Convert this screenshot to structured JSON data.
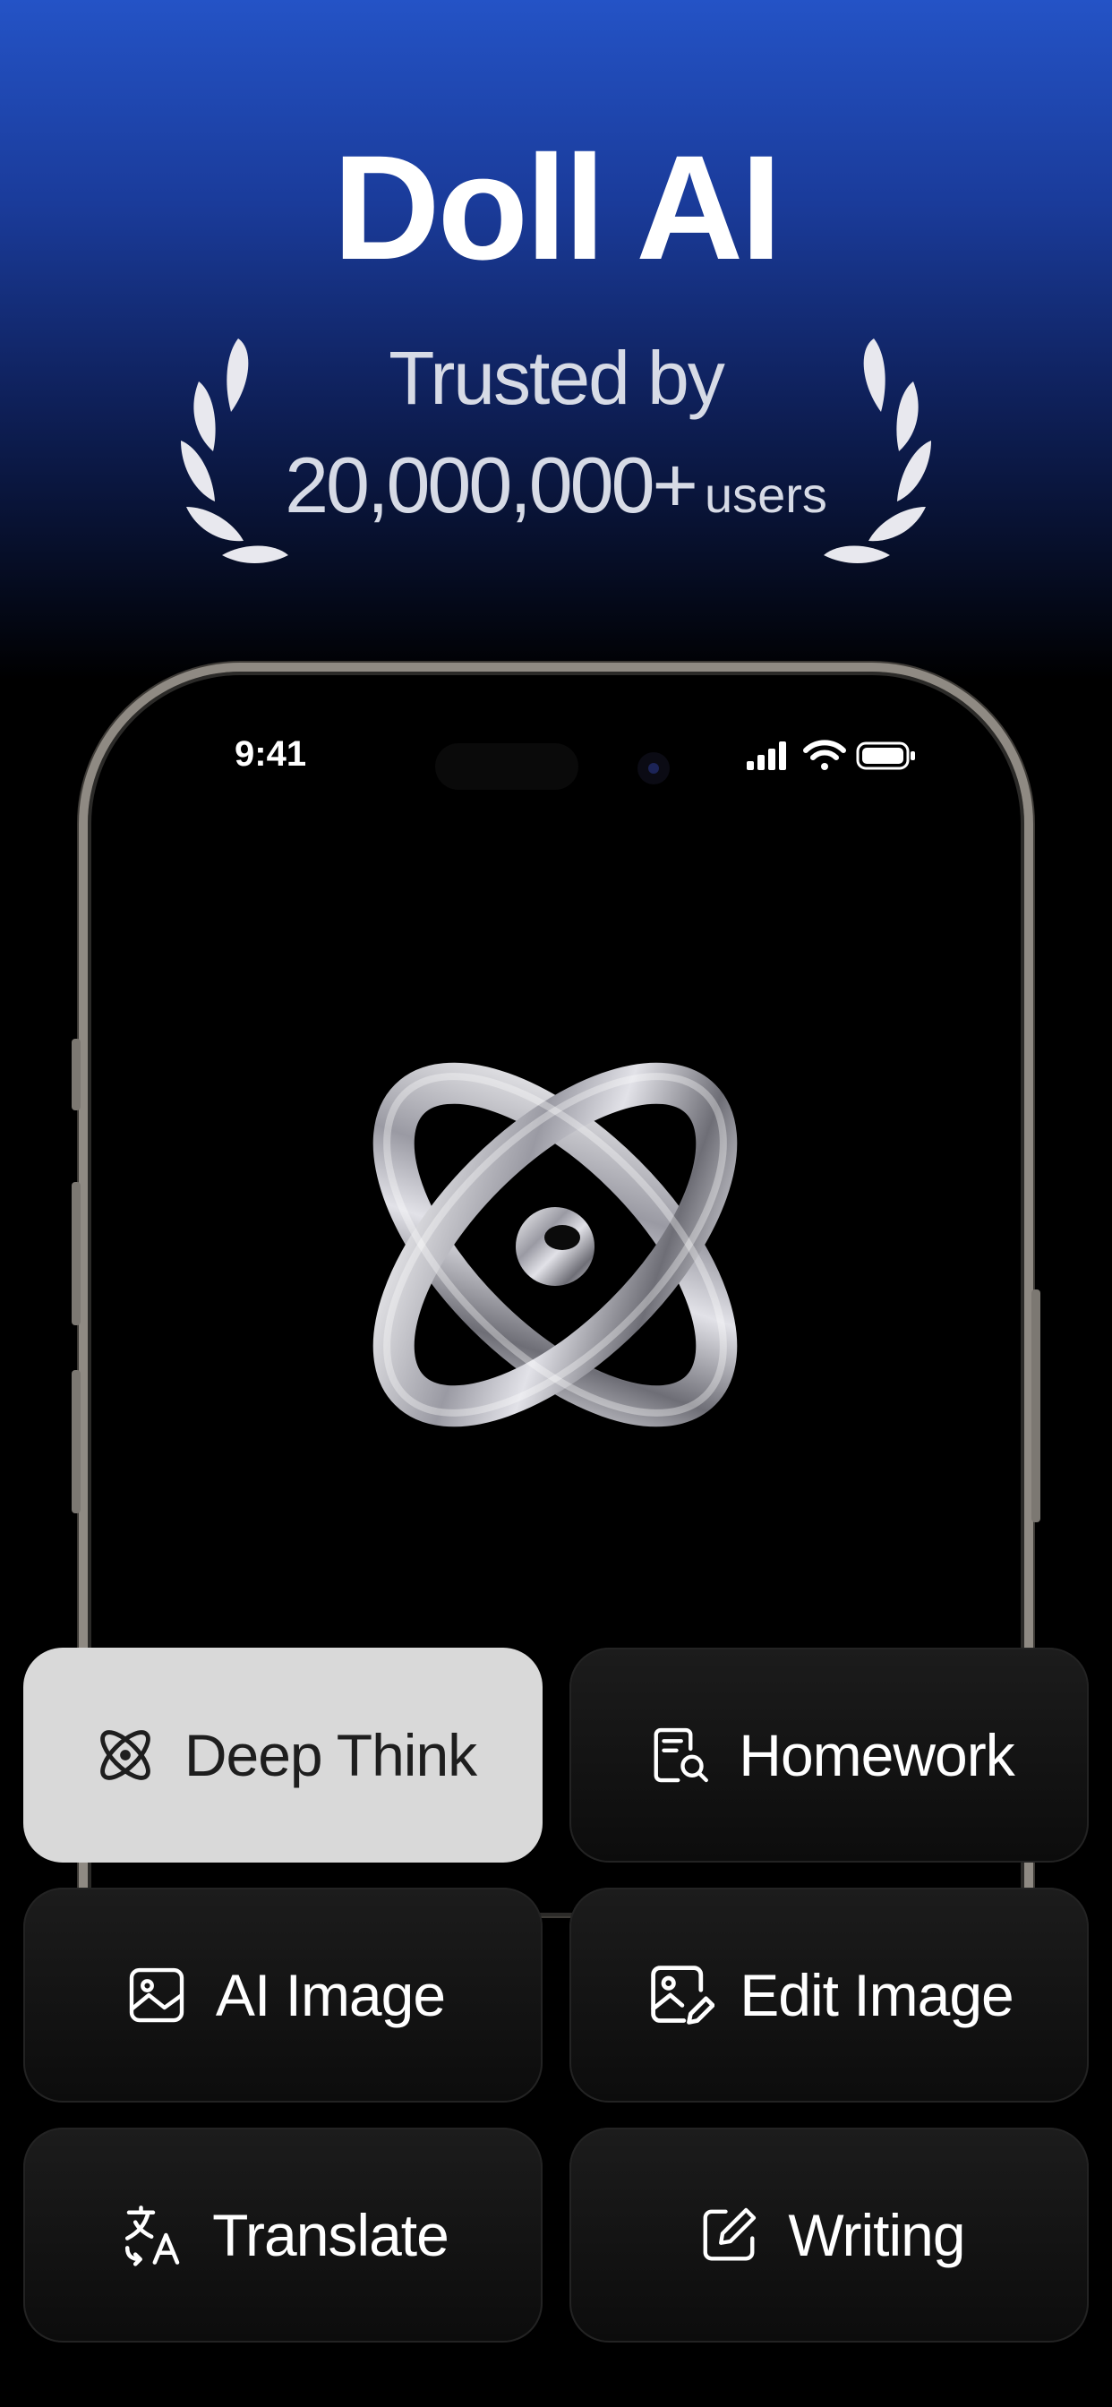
{
  "hero": {
    "title": "Doll AI",
    "trusted_by": "Trusted by",
    "user_count": "20,000,000+",
    "user_unit": "users"
  },
  "status_bar": {
    "time": "9:41"
  },
  "features": [
    {
      "label": "Deep Think",
      "icon": "atom-icon",
      "active": true
    },
    {
      "label": "Homework",
      "icon": "document-search-icon",
      "active": false
    },
    {
      "label": "AI Image",
      "icon": "image-icon",
      "active": false
    },
    {
      "label": "Edit Image",
      "icon": "image-edit-icon",
      "active": false
    },
    {
      "label": "Translate",
      "icon": "translate-icon",
      "active": false
    },
    {
      "label": "Writing",
      "icon": "pencil-square-icon",
      "active": false
    }
  ],
  "colors": {
    "brand_blue": "#2453c6",
    "active_card": "#d9d9d9",
    "card_dark": "#141414"
  }
}
